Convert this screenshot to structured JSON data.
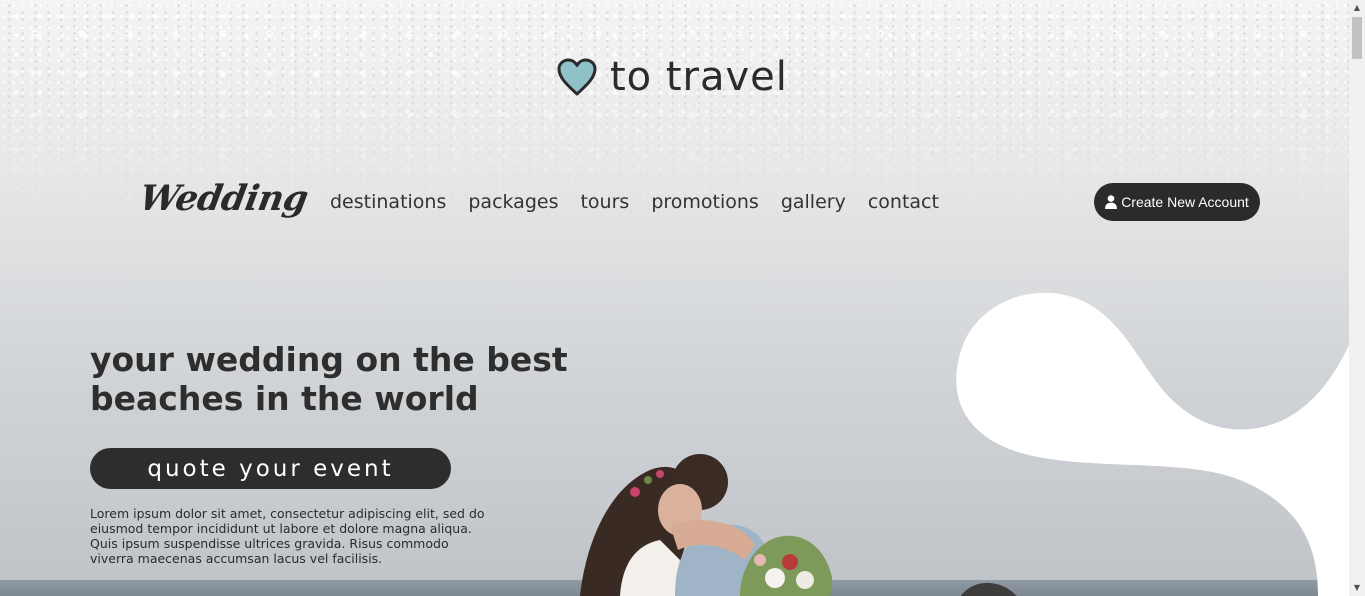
{
  "brand": {
    "logo_icon": "heart-icon",
    "heart_color": "#8fc1c9",
    "text": "to travel"
  },
  "nav": {
    "logo": "Wedding",
    "items": [
      {
        "label": "destinations"
      },
      {
        "label": "packages"
      },
      {
        "label": "tours"
      },
      {
        "label": "promotions"
      },
      {
        "label": "gallery"
      },
      {
        "label": "contact"
      }
    ],
    "create_account": {
      "icon": "user-icon",
      "label": "Create New Account"
    }
  },
  "hero": {
    "title": "your wedding on the best beaches in the world",
    "cta": "quote your event",
    "text": "Lorem ipsum dolor sit amet, consectetur adipiscing elit, sed do eiusmod tempor incididunt ut labore et dolore magna aliqua. Quis ipsum suspendisse ultrices gravida. Risus commodo viverra maecenas accumsan lacus vel facilisis."
  },
  "colors": {
    "dark": "#2b2b2b",
    "accent": "#8fc1c9",
    "background": "#e3e4e6"
  },
  "scrollbar": {
    "up_icon": "scroll-up-arrow-icon",
    "down_icon": "scroll-down-arrow-icon"
  }
}
